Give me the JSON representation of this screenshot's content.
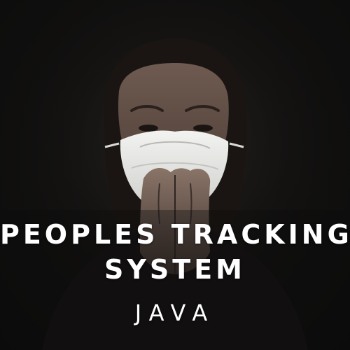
{
  "poster": {
    "title_line_1": "PEOPLES TRACKING",
    "title_line_2": "SYSTEM",
    "subtitle": "JAVA"
  },
  "colors": {
    "background": "#0f0f0f",
    "text": "#ffffff",
    "mask": "#e8e8e6"
  }
}
